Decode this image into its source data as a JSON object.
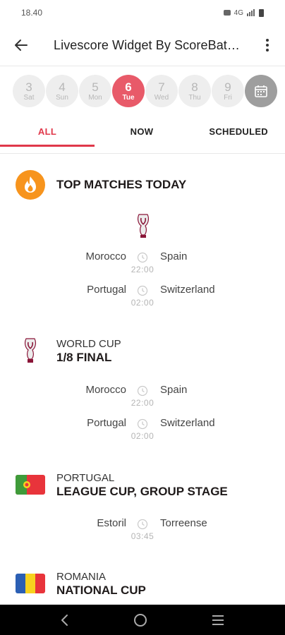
{
  "status_bar": {
    "time": "18.40",
    "network": "4G"
  },
  "app_bar": {
    "title": "Livescore Widget By ScoreBat…"
  },
  "days": [
    {
      "num": "3",
      "name": "Sat",
      "active": false
    },
    {
      "num": "4",
      "name": "Sun",
      "active": false
    },
    {
      "num": "5",
      "name": "Mon",
      "active": false
    },
    {
      "num": "6",
      "name": "Tue",
      "active": true
    },
    {
      "num": "7",
      "name": "Wed",
      "active": false
    },
    {
      "num": "8",
      "name": "Thu",
      "active": false
    },
    {
      "num": "9",
      "name": "Fri",
      "active": false
    }
  ],
  "tabs": [
    {
      "label": "ALL",
      "active": true
    },
    {
      "label": "NOW",
      "active": false
    },
    {
      "label": "SCHEDULED",
      "active": false
    }
  ],
  "top_matches": {
    "title": "TOP MATCHES TODAY",
    "matches": [
      {
        "home": "Morocco",
        "away": "Spain",
        "time": "22:00"
      },
      {
        "home": "Portugal",
        "away": "Switzerland",
        "time": "02:00"
      }
    ]
  },
  "competitions": [
    {
      "country": "WORLD CUP",
      "name": "1/8 FINAL",
      "icon": "world-cup-trophy-icon",
      "matches": [
        {
          "home": "Morocco",
          "away": "Spain",
          "time": "22:00"
        },
        {
          "home": "Portugal",
          "away": "Switzerland",
          "time": "02:00"
        }
      ]
    },
    {
      "country": "PORTUGAL",
      "name": "LEAGUE CUP, GROUP STAGE",
      "icon": "portugal-flag-icon",
      "matches": [
        {
          "home": "Estoril",
          "away": "Torreense",
          "time": "03:45"
        }
      ]
    },
    {
      "country": "ROMANIA",
      "name": "NATIONAL CUP",
      "icon": "romania-flag-icon",
      "matches": []
    }
  ],
  "colors": {
    "accent": "#e0384a",
    "active_day": "#e85a69",
    "chip_bg": "#eeeeee",
    "fire_badge": "#f7941d"
  }
}
